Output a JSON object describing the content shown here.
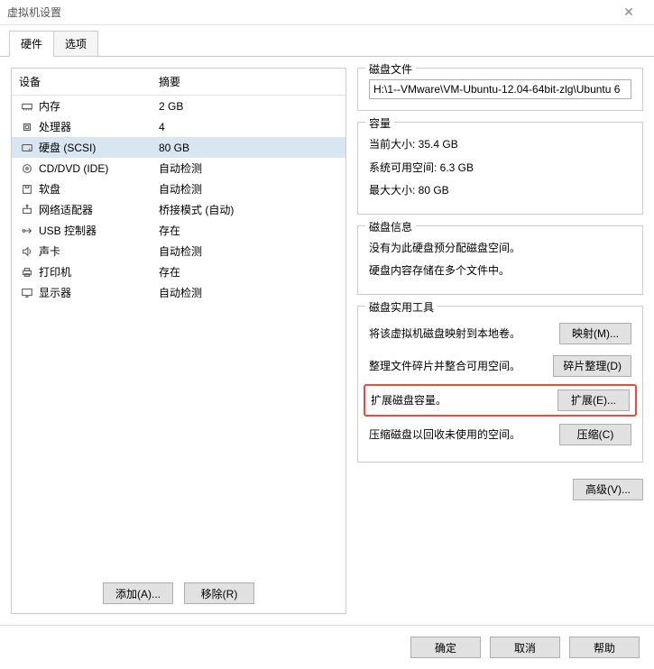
{
  "window": {
    "title": "虚拟机设置"
  },
  "tabs": {
    "hardware": "硬件",
    "options": "选项"
  },
  "table": {
    "device_header": "设备",
    "summary_header": "摘要"
  },
  "devices": [
    {
      "icon": "memory",
      "name": "内存",
      "summary": "2 GB"
    },
    {
      "icon": "cpu",
      "name": "处理器",
      "summary": "4"
    },
    {
      "icon": "disk",
      "name": "硬盘 (SCSI)",
      "summary": "80 GB",
      "selected": true
    },
    {
      "icon": "cd",
      "name": "CD/DVD (IDE)",
      "summary": "自动检测"
    },
    {
      "icon": "floppy",
      "name": "软盘",
      "summary": "自动检测"
    },
    {
      "icon": "network",
      "name": "网络适配器",
      "summary": "桥接模式 (自动)"
    },
    {
      "icon": "usb",
      "name": "USB 控制器",
      "summary": "存在"
    },
    {
      "icon": "sound",
      "name": "声卡",
      "summary": "自动检测"
    },
    {
      "icon": "printer",
      "name": "打印机",
      "summary": "存在"
    },
    {
      "icon": "display",
      "name": "显示器",
      "summary": "自动检测"
    }
  ],
  "buttons": {
    "add": "添加(A)...",
    "remove": "移除(R)"
  },
  "disk_file": {
    "legend": "磁盘文件",
    "path": "H:\\1--VMware\\VM-Ubuntu-12.04-64bit-zlg\\Ubuntu 6"
  },
  "capacity": {
    "legend": "容量",
    "current": "当前大小: 35.4 GB",
    "free": "系统可用空间: 6.3 GB",
    "max": "最大大小: 80 GB"
  },
  "disk_info": {
    "legend": "磁盘信息",
    "line1": "没有为此硬盘预分配磁盘空间。",
    "line2": "硬盘内容存储在多个文件中。"
  },
  "tools": {
    "legend": "磁盘实用工具",
    "map_desc": "将该虚拟机磁盘映射到本地卷。",
    "map_btn": "映射(M)...",
    "defrag_desc": "整理文件碎片并整合可用空间。",
    "defrag_btn": "碎片整理(D)",
    "expand_desc": "扩展磁盘容量。",
    "expand_btn": "扩展(E)...",
    "compact_desc": "压缩磁盘以回收未使用的空间。",
    "compact_btn": "压缩(C)"
  },
  "advanced_btn": "高级(V)...",
  "footer": {
    "ok": "确定",
    "cancel": "取消",
    "help": "帮助"
  }
}
